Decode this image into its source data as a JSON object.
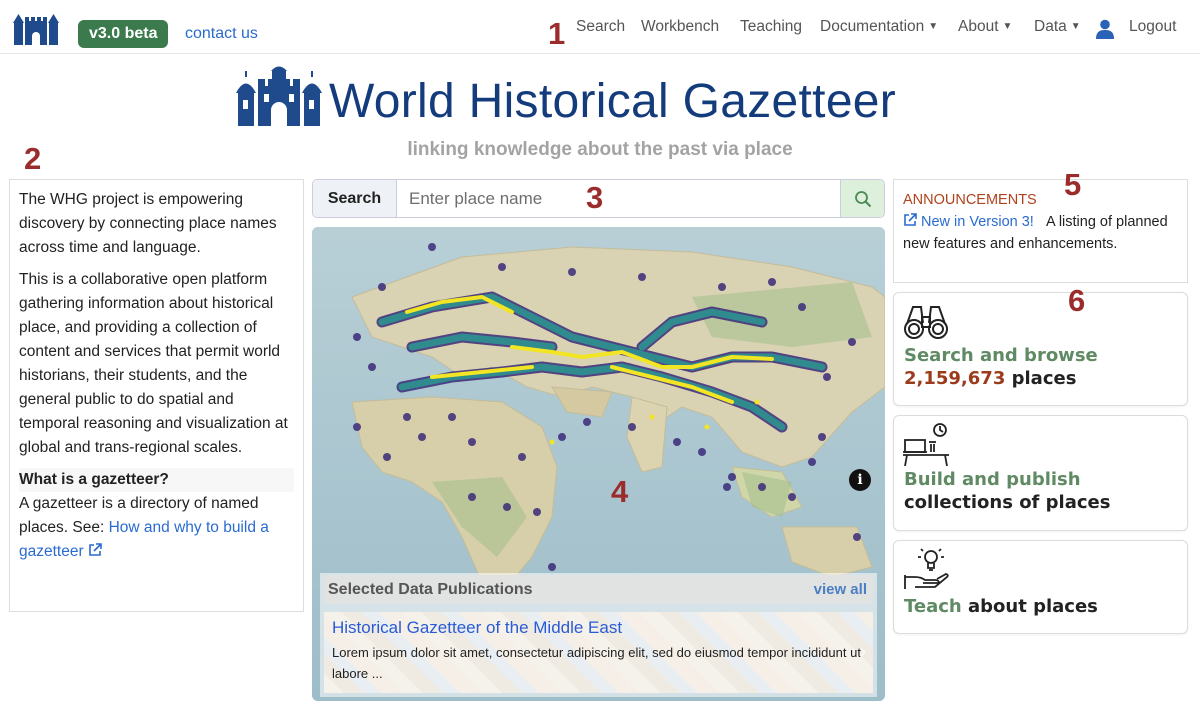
{
  "navbar": {
    "badge": "v3.0 beta",
    "contact": "contact us",
    "items": [
      {
        "label": "Search"
      },
      {
        "label": "Workbench"
      },
      {
        "label": "Teaching"
      },
      {
        "label": "Documentation"
      },
      {
        "label": "About"
      },
      {
        "label": "Data"
      },
      {
        "label": "Logout"
      }
    ]
  },
  "markers": {
    "m1": "1",
    "m2": "2",
    "m3": "3",
    "m4": "4",
    "m5": "5",
    "m6": "6"
  },
  "hero": {
    "title": "World Historical Gazetteer",
    "subtitle": "linking knowledge about the past via place"
  },
  "left_panel": {
    "p1": "The WHG project is empowering discovery by connecting place names across time and language.",
    "p2": "This is a collaborative open platform gathering information about historical place, and providing a collection of content and services that permit world historians, their students, and the general public to do spatial and temporal reasoning and visualization at global and trans-regional scales.",
    "gaz_heading": "What is a gazetteer?",
    "gaz_text": "A gazetteer is a directory of named places. See: ",
    "gaz_link": "How and why to build a gazetteer"
  },
  "search": {
    "label": "Search",
    "placeholder": "Enter place name"
  },
  "map": {
    "publications": {
      "heading": "Selected Data Publications",
      "view_all": "view all",
      "items": [
        {
          "title": "Historical Gazetteer of the Middle East",
          "desc": "Lorem ipsum dolor sit amet, consectetur adipiscing elit, sed do eiusmod tempor incididunt ut labore ..."
        }
      ]
    }
  },
  "announcements": {
    "title": "ANNOUNCEMENTS",
    "link": "New in Version 3!",
    "text": "A listing of planned new features and enhancements."
  },
  "cards": {
    "search": {
      "line1": "Search and browse",
      "count": "2,159,673",
      "line2_rest": " places"
    },
    "build": {
      "line1": "Build and publish",
      "line2": "collections of places"
    },
    "teach": {
      "word": "Teach",
      "rest": " about places"
    }
  },
  "colors": {
    "brand_blue": "#143c7d",
    "badge_green": "#3b7a4c",
    "marker_red": "#9b2c2c",
    "link_blue": "#2a6bd1"
  }
}
